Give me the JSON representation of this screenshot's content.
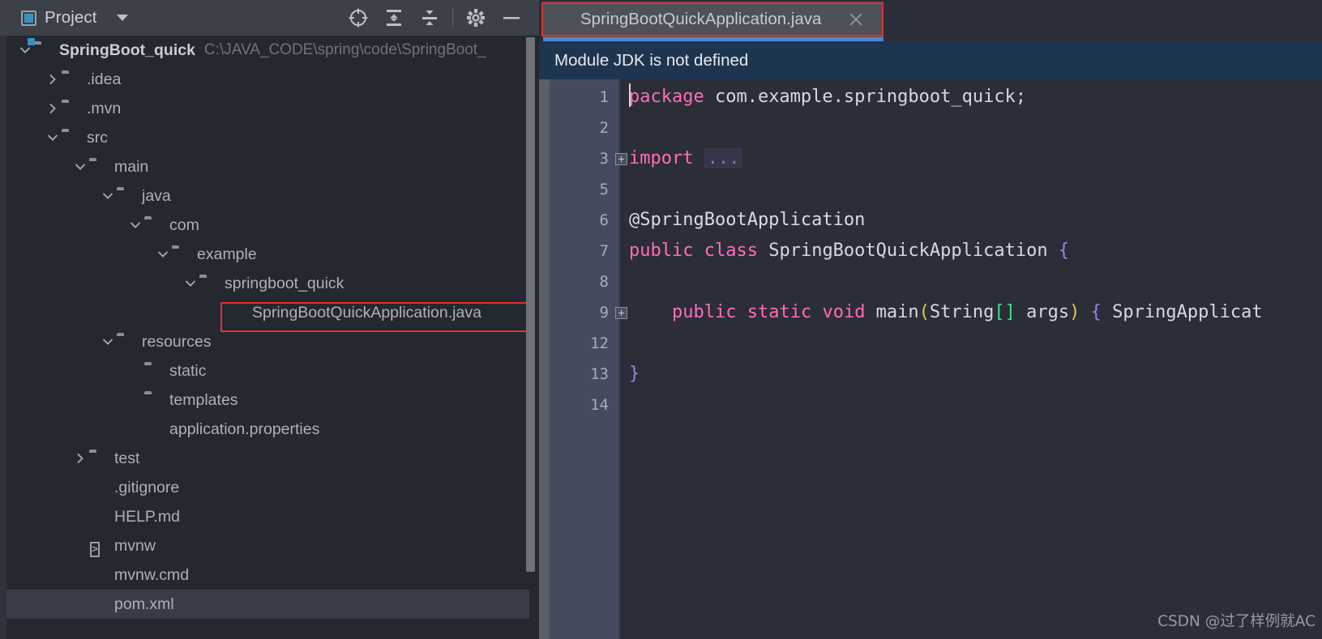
{
  "window": {
    "bg_color": "#262A33"
  },
  "sidebar": {
    "toolbar": {
      "title": "Project",
      "dropdown_icon": "chevron-down-icon",
      "buttons": [
        {
          "name": "select-opened-file-icon",
          "label": "Select Opened File"
        },
        {
          "name": "expand-all-icon",
          "label": "Expand All"
        },
        {
          "name": "collapse-all-icon",
          "label": "Collapse All"
        },
        {
          "name": "gear-icon",
          "label": "Settings"
        },
        {
          "name": "minimize-icon",
          "label": "Hide"
        }
      ]
    },
    "tree": [
      {
        "label": "SpringBoot_quick",
        "sub": "C:\\JAVA_CODE\\spring\\code\\SpringBoot_",
        "depth": 0,
        "arrow": "down",
        "icon": "module",
        "bold": true
      },
      {
        "label": ".idea",
        "sub": "",
        "depth": 1,
        "arrow": "right",
        "icon": "folder",
        "bold": false
      },
      {
        "label": ".mvn",
        "sub": "",
        "depth": 1,
        "arrow": "right",
        "icon": "folder",
        "bold": false
      },
      {
        "label": "src",
        "sub": "",
        "depth": 1,
        "arrow": "down",
        "icon": "folder",
        "bold": false
      },
      {
        "label": "main",
        "sub": "",
        "depth": 2,
        "arrow": "down",
        "icon": "folder",
        "bold": false
      },
      {
        "label": "java",
        "sub": "",
        "depth": 3,
        "arrow": "down",
        "icon": "folder",
        "bold": false
      },
      {
        "label": "com",
        "sub": "",
        "depth": 4,
        "arrow": "down",
        "icon": "folder",
        "bold": false
      },
      {
        "label": "example",
        "sub": "",
        "depth": 5,
        "arrow": "down",
        "icon": "folder",
        "bold": false
      },
      {
        "label": "springboot_quick",
        "sub": "",
        "depth": 6,
        "arrow": "down",
        "icon": "folder",
        "bold": false
      },
      {
        "label": "SpringBootQuickApplication.java",
        "sub": "",
        "depth": 7,
        "arrow": "none",
        "icon": "java-file",
        "bold": false
      },
      {
        "label": "resources",
        "sub": "",
        "depth": 3,
        "arrow": "down",
        "icon": "folder",
        "bold": false
      },
      {
        "label": "static",
        "sub": "",
        "depth": 4,
        "arrow": "none",
        "icon": "folder",
        "bold": false
      },
      {
        "label": "templates",
        "sub": "",
        "depth": 4,
        "arrow": "none",
        "icon": "folder",
        "bold": false
      },
      {
        "label": "application.properties",
        "sub": "",
        "depth": 4,
        "arrow": "none",
        "icon": "properties-file",
        "bold": false
      },
      {
        "label": "test",
        "sub": "",
        "depth": 2,
        "arrow": "right",
        "icon": "folder",
        "bold": false
      },
      {
        "label": ".gitignore",
        "sub": "",
        "depth": 2,
        "arrow": "none",
        "icon": "gitignore-file",
        "bold": false
      },
      {
        "label": "HELP.md",
        "sub": "",
        "depth": 2,
        "arrow": "none",
        "icon": "markdown-file",
        "bold": false
      },
      {
        "label": "mvnw",
        "sub": "",
        "depth": 2,
        "arrow": "none",
        "icon": "script-file",
        "bold": false
      },
      {
        "label": "mvnw.cmd",
        "sub": "",
        "depth": 2,
        "arrow": "none",
        "icon": "cmd-file",
        "bold": false
      },
      {
        "label": "pom.xml",
        "sub": "",
        "depth": 2,
        "arrow": "none",
        "icon": "xml-file",
        "bold": false
      }
    ],
    "highlight_row_index": 19,
    "annotation_box": {
      "color": "#E03131",
      "around_row_index": 9
    }
  },
  "editor": {
    "tab": {
      "label": "SpringBootQuickApplication.java",
      "icon": "java-file-icon",
      "close_icon": "close-icon",
      "active": true,
      "underline_color": "#4A88D8",
      "annotation_box_color": "#E03131"
    },
    "notification": {
      "text": "Module JDK is not defined",
      "bg_color": "#1E3550"
    },
    "line_numbers": [
      "1",
      "2",
      "3",
      "5",
      "6",
      "7",
      "8",
      "9",
      "12",
      "13",
      "14"
    ],
    "lines": [
      {
        "num": "1",
        "tokens": [
          {
            "t": "package",
            "c": "kw"
          },
          {
            "t": " com.example.springboot_quick;",
            "c": "txt"
          }
        ],
        "fold": false
      },
      {
        "num": "2",
        "tokens": [],
        "fold": false
      },
      {
        "num": "3",
        "tokens": [
          {
            "t": "import",
            "c": "kw"
          },
          {
            "t": " ",
            "c": "txt"
          },
          {
            "t": "...",
            "c": "fold-ellipsis"
          }
        ],
        "fold": true
      },
      {
        "num": "5",
        "tokens": [],
        "fold": false
      },
      {
        "num": "6",
        "tokens": [
          {
            "t": "@SpringBootApplication",
            "c": "ann"
          }
        ],
        "fold": false
      },
      {
        "num": "7",
        "tokens": [
          {
            "t": "public",
            "c": "kw"
          },
          {
            "t": " ",
            "c": "txt"
          },
          {
            "t": "class",
            "c": "kw"
          },
          {
            "t": " SpringBootQuickApplication ",
            "c": "txt"
          },
          {
            "t": "{",
            "c": "brace"
          }
        ],
        "fold": false
      },
      {
        "num": "8",
        "tokens": [],
        "fold": false
      },
      {
        "num": "9",
        "tokens": [
          {
            "t": "    ",
            "c": "txt"
          },
          {
            "t": "public",
            "c": "kw"
          },
          {
            "t": " ",
            "c": "txt"
          },
          {
            "t": "static",
            "c": "kw"
          },
          {
            "t": " ",
            "c": "txt"
          },
          {
            "t": "void",
            "c": "kw"
          },
          {
            "t": " main",
            "c": "txt"
          },
          {
            "t": "(",
            "c": "paren"
          },
          {
            "t": "String",
            "c": "txt"
          },
          {
            "t": "[]",
            "c": "brkt"
          },
          {
            "t": " args",
            "c": "txt"
          },
          {
            "t": ")",
            "c": "paren"
          },
          {
            "t": " ",
            "c": "txt"
          },
          {
            "t": "{",
            "c": "brace"
          },
          {
            "t": " SpringApplicat",
            "c": "txt"
          }
        ],
        "fold": true
      },
      {
        "num": "12",
        "tokens": [],
        "fold": false
      },
      {
        "num": "13",
        "tokens": [
          {
            "t": "}",
            "c": "brace"
          }
        ],
        "fold": false
      },
      {
        "num": "14",
        "tokens": [],
        "fold": false
      }
    ],
    "watermark": "CSDN @过了样例就AC"
  }
}
